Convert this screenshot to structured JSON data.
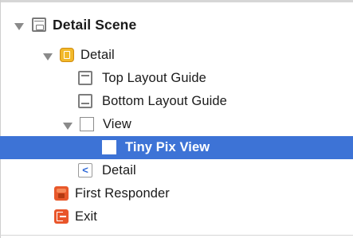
{
  "outline": {
    "items": [
      {
        "label": "Detail Scene",
        "icon": "scene-icon",
        "expanded": true,
        "selected": false
      },
      {
        "label": "Detail",
        "icon": "view-controller-icon",
        "expanded": true,
        "selected": false
      },
      {
        "label": "Top Layout Guide",
        "icon": "top-layout-guide-icon",
        "selected": false
      },
      {
        "label": "Bottom Layout Guide",
        "icon": "bottom-layout-guide-icon",
        "selected": false
      },
      {
        "label": "View",
        "icon": "view-icon",
        "expanded": true,
        "selected": false
      },
      {
        "label": "Tiny Pix View",
        "icon": "view-icon",
        "selected": true
      },
      {
        "label": "Detail",
        "icon": "back-item-icon",
        "glyph": "<",
        "selected": false
      },
      {
        "label": "First Responder",
        "icon": "first-responder-icon",
        "selected": false
      },
      {
        "label": "Exit",
        "icon": "exit-icon",
        "selected": false
      }
    ]
  },
  "colors": {
    "selection": "#3d73d6",
    "text": "#1a1a1a",
    "selected_text": "#ffffff",
    "controller_icon": "#f2b92a",
    "responder_icon": "#e8582a",
    "exit_icon": "#e9552a"
  }
}
